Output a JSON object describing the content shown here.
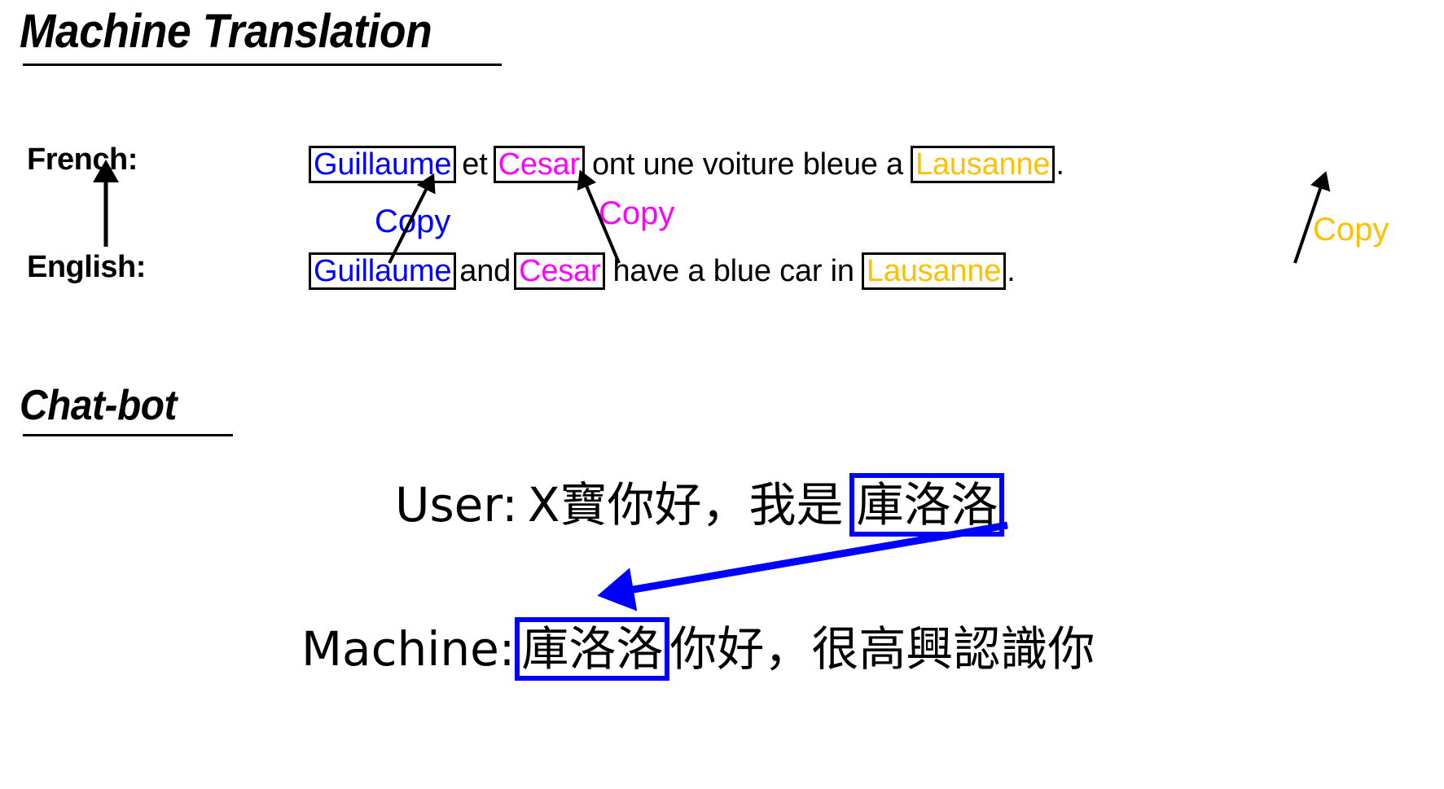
{
  "slide": {
    "background": "#ffffff",
    "sections": [
      {
        "id": "machine-translation",
        "heading": "Machine Translation"
      },
      {
        "id": "chat-bot",
        "heading": "Chat-bot"
      }
    ]
  },
  "colors": {
    "blue": "#0000FF",
    "magenta": "#FF00FF",
    "gold": "#FFC000",
    "black": "#000000",
    "arrow_blue": "#0000FF"
  },
  "machine_translation": {
    "heading": "Machine Translation",
    "labels": {
      "source": "French:",
      "target": "English:"
    },
    "french_sentence": {
      "tokens": [
        {
          "text": "Guillaume",
          "color": "blue",
          "boxed": true
        },
        {
          "text": "et",
          "color": "black",
          "boxed": false
        },
        {
          "text": "Cesar",
          "color": "magenta",
          "boxed": true
        },
        {
          "text": "ont une voiture bleue a",
          "color": "black",
          "boxed": false
        },
        {
          "text": "Lausanne",
          "color": "gold",
          "boxed": true
        },
        {
          "text": ".",
          "color": "black",
          "boxed": false
        }
      ],
      "plain_text": "Guillaume et Cesar ont une voiture bleue a Lausanne."
    },
    "english_sentence": {
      "tokens": [
        {
          "text": "Guillaume",
          "color": "blue",
          "boxed": true
        },
        {
          "text": "and",
          "color": "black",
          "boxed": false
        },
        {
          "text": "Cesar",
          "color": "magenta",
          "boxed": true
        },
        {
          "text": "have a blue car in",
          "color": "black",
          "boxed": false
        },
        {
          "text": "Lausanne",
          "color": "gold",
          "boxed": true
        },
        {
          "text": ".",
          "color": "black",
          "boxed": false
        }
      ],
      "plain_text": "Guillaume and Cesar have a blue car in Lausanne."
    },
    "tokens": {
      "french_1": "Guillaume",
      "french_et": "et",
      "french_2": "Cesar",
      "french_mid": "ont une voiture bleue a",
      "french_3": "Lausanne",
      "french_period": ".",
      "english_1": "Guillaume",
      "english_and": "and",
      "english_2": "Cesar",
      "english_mid": "have a blue car in",
      "english_3": "Lausanne",
      "english_period": "."
    },
    "copy_annotations": [
      {
        "label": "Copy",
        "color": "blue"
      },
      {
        "label": "Copy",
        "color": "magenta"
      },
      {
        "label": "Copy",
        "color": "gold"
      }
    ],
    "copy_labels": {
      "first": "Copy",
      "second": "Copy",
      "third": "Copy"
    }
  },
  "chat_bot": {
    "heading": "Chat-bot",
    "turns": [
      {
        "speaker": "User:",
        "prefix": "X寶你好，我是",
        "highlight": "庫洛洛",
        "suffix": "",
        "highlight_color": "blue"
      },
      {
        "speaker": "Machine:",
        "prefix": "",
        "highlight": "庫洛洛",
        "suffix": "你好，很高興認識你",
        "highlight_color": "blue"
      }
    ],
    "user_line": {
      "speaker": "User:",
      "text_before": "X寶你好，我是",
      "boxed_name": "庫洛洛"
    },
    "machine_line": {
      "speaker": "Machine:",
      "boxed_name": "庫洛洛",
      "text_after": "你好，很高興認識你"
    }
  }
}
